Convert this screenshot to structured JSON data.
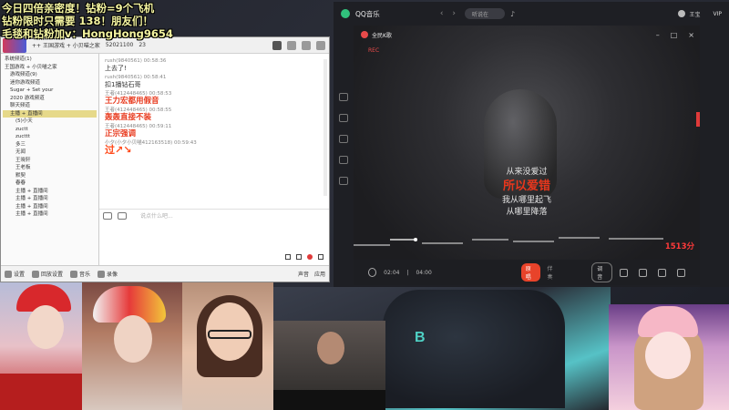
{
  "overlay": {
    "line1": "今日四倍亲密度！钻粉=9个飞机",
    "line2": "钻粉限时只需要 138！朋友们！",
    "line3": "毛毯和钻粉加v：HongHong9654"
  },
  "yy": {
    "top_text": "++ 王国游戏 + 小贝喵之家",
    "top_id": "52021100",
    "top_count": "23",
    "tree": [
      "系统频道(1)",
      "王国游戏 + 小贝喵之家",
      "游戏频道(9)",
      "迷你游戏频道",
      "Sugar + Set your",
      "2020 游戏频道",
      "聊天频道",
      "主播 + 直播间",
      "(5)小天",
      "zuctt",
      "zucttt",
      "多三",
      "无闻",
      "王晓轩",
      "王老板",
      "默契",
      "春春",
      "主播 + 直播间",
      "主播 + 直播间",
      "主播 + 直播间",
      "主播 + 直播间"
    ],
    "messages": [
      {
        "meta": "rush(9840561) 00:58:36",
        "text": "上去了!",
        "style": "normal"
      },
      {
        "meta": "rush(9840561) 00:58:41",
        "text": "扣1播钻石哥",
        "style": "normal"
      },
      {
        "meta": "王者(412448465) 00:58:53",
        "text": "王力宏都用假音",
        "style": "red"
      },
      {
        "meta": "王者(412448465) 00:58:55",
        "text": "轰轰直接不装",
        "style": "red"
      },
      {
        "meta": "王者(412448465) 00:59:11",
        "text": "正宗强调",
        "style": "red"
      },
      {
        "meta": "小夕(小夕小贝喵412163518) 00:59:43",
        "text": "过↗↘",
        "style": "big"
      }
    ],
    "input_placeholder": "说点什么吧...",
    "bottom": {
      "b1": "设置",
      "b2": "回放设置",
      "b3": "音乐",
      "b4": "录像",
      "right1": "声音",
      "right2": "应用"
    }
  },
  "qq": {
    "title": "QQ音乐",
    "search_placeholder": "听说在",
    "user": "王宝",
    "vip": "VIP",
    "lyric_title": "全民K歌",
    "rec": "REC",
    "lyrics": [
      "从来没爱过",
      "所以爱错",
      "我从哪里起飞",
      "从哪里降落"
    ],
    "current_index": 1,
    "score": "1513分",
    "time_current": "02:04",
    "time_total": "04:00",
    "pill": "原唱",
    "pill2": "伴奏",
    "box": "调音"
  },
  "colors": {
    "overlay_text": "#f4f4a0",
    "lyric_current": "#e8371d",
    "score": "#ff3a3a",
    "qq_green": "#31c27c"
  }
}
